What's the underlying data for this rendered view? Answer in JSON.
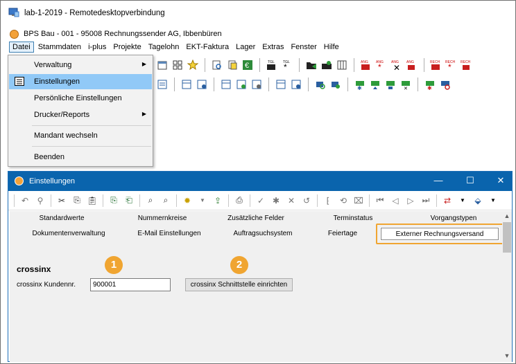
{
  "window": {
    "rdp_title": "lab-1-2019 - Remotedesktopverbindung",
    "app_title": "BPS Bau - 001 - 95008 Rechnungssender AG, Ibbenbüren"
  },
  "menubar": [
    "Datei",
    "Stammdaten",
    "i-plus",
    "Projekte",
    "Tagelohn",
    "EKT-Faktura",
    "Lager",
    "Extras",
    "Fenster",
    "Hilfe"
  ],
  "datei_menu": {
    "items": [
      {
        "label": "Verwaltung",
        "submenu": true
      },
      {
        "label": "Einstellungen",
        "submenu": false
      },
      {
        "label": "Persönliche Einstellungen",
        "submenu": false
      },
      {
        "label": "Drucker/Reports",
        "submenu": true
      },
      {
        "label": "Mandant wechseln",
        "submenu": false
      },
      {
        "label": "Beenden",
        "submenu": false
      }
    ]
  },
  "toolbar_labels": {
    "ang": "ANG",
    "rech": "RECH",
    "tgl": "TGL"
  },
  "dialog": {
    "title": "Einstellungen",
    "controls": {
      "minimize": "—",
      "maximize": "☐",
      "close": "✕"
    },
    "tabs_row1": [
      "Standardwerte",
      "Nummernkreise",
      "Zusätzliche Felder",
      "Terminstatus",
      "Vorgangstypen"
    ],
    "tabs_row2": [
      "Dokumentenverwaltung",
      "E-Mail Einstellungen",
      "Auftragsuchsystem",
      "Feiertage",
      "Externer Rechnungsversand"
    ],
    "active_tab": "Externer Rechnungsversand",
    "section_title": "crossinx",
    "customer_label": "crossinx Kundennr.",
    "customer_value": "900001",
    "setup_button": "crossinx Schnittstelle einrichten",
    "badges": [
      "1",
      "2"
    ]
  },
  "colors": {
    "highlight": "#f0a531",
    "dialog_titlebar": "#0a64ad",
    "menu_hover": "#91c9f7"
  }
}
